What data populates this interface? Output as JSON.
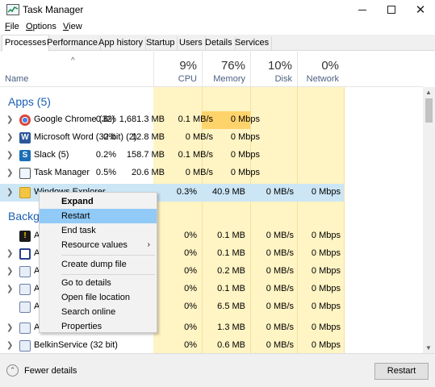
{
  "window": {
    "title": "Task Manager",
    "min_icon": "minimize-icon",
    "max_icon": "maximize-icon",
    "close_icon": "close-icon"
  },
  "menu": [
    {
      "label": "File",
      "accel": "F",
      "rest": "ile"
    },
    {
      "label": "Options",
      "accel": "O",
      "rest": "ptions"
    },
    {
      "label": "View",
      "accel": "V",
      "rest": "iew"
    }
  ],
  "tabs": [
    "Processes",
    "Performance",
    "App history",
    "Startup",
    "Users",
    "Details",
    "Services"
  ],
  "active_tab": "Processes",
  "columns": {
    "name": "Name",
    "cpu": {
      "pct": "9%",
      "label": "CPU"
    },
    "memory": {
      "pct": "76%",
      "label": "Memory"
    },
    "disk": {
      "pct": "10%",
      "label": "Disk"
    },
    "network": {
      "pct": "0%",
      "label": "Network"
    }
  },
  "groups": {
    "apps": "Apps (5)",
    "background": "Backgr"
  },
  "apps": [
    {
      "name": "Google Chrome (32)",
      "cpu": "0.6%",
      "mem": "1,681.3 MB",
      "disk": "0.1 MB/s",
      "net": "0 Mbps",
      "icon": "chrome-icon"
    },
    {
      "name": "Microsoft Word (32 bit) (2)",
      "cpu": "0%",
      "mem": "12.8 MB",
      "disk": "0 MB/s",
      "net": "0 Mbps",
      "icon": "word-icon"
    },
    {
      "name": "Slack (5)",
      "cpu": "0.2%",
      "mem": "158.7 MB",
      "disk": "0.1 MB/s",
      "net": "0 Mbps",
      "icon": "slack-icon"
    },
    {
      "name": "Task Manager",
      "cpu": "0.5%",
      "mem": "20.6 MB",
      "disk": "0 MB/s",
      "net": "0 Mbps",
      "icon": "task-manager-icon"
    },
    {
      "name": "Windows Explorer",
      "cpu": "0.3%",
      "mem": "40.9 MB",
      "disk": "0 MB/s",
      "net": "0 Mbps",
      "icon": "explorer-icon"
    }
  ],
  "background": [
    {
      "name": "A",
      "cpu": "0%",
      "mem": "0.1 MB",
      "disk": "0 MB/s",
      "net": "0 Mbps",
      "icon": "warning-app-icon"
    },
    {
      "name": "A",
      "cpu": "0%",
      "mem": "0.1 MB",
      "disk": "0 MB/s",
      "net": "0 Mbps",
      "icon": "window-app-icon"
    },
    {
      "name": "A",
      "cpu": "0%",
      "mem": "0.2 MB",
      "disk": "0 MB/s",
      "net": "0 Mbps",
      "icon": "service-icon"
    },
    {
      "name": "A",
      "cpu": "0%",
      "mem": "0.1 MB",
      "disk": "0 MB/s",
      "net": "0 Mbps",
      "icon": "service-icon"
    },
    {
      "name": "A",
      "cpu": "0%",
      "mem": "6.5 MB",
      "disk": "0 MB/s",
      "net": "0 Mbps",
      "icon": "service-icon"
    },
    {
      "name": "A",
      "cpu": "0%",
      "mem": "1.3 MB",
      "disk": "0 MB/s",
      "net": "0 Mbps",
      "icon": "service-icon"
    },
    {
      "name": "BelkinService (32 bit)",
      "cpu": "0%",
      "mem": "0.6 MB",
      "disk": "0 MB/s",
      "net": "0 Mbps",
      "icon": "service-icon"
    }
  ],
  "context_menu": [
    {
      "label": "Expand"
    },
    {
      "label": "Restart"
    },
    {
      "label": "End task"
    },
    {
      "label": "Resource values"
    },
    {
      "label": "Create dump file"
    },
    {
      "label": "Go to details"
    },
    {
      "label": "Open file location"
    },
    {
      "label": "Search online"
    },
    {
      "label": "Properties"
    }
  ],
  "footer": {
    "fewer_details": "Fewer details",
    "action_button": "Restart"
  },
  "colors": {
    "cpu_bg": "#fff4c4",
    "mem_hot": "#ffd36b",
    "selected_row": "#cce6f5",
    "menu_highlight": "#91c9f7",
    "group_header": "#1a5fb4"
  }
}
